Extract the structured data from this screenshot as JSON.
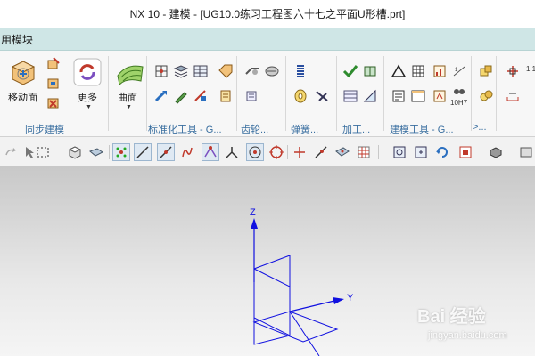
{
  "window": {
    "title": "NX 10 - 建模 - [UG10.0练习工程图六十七之平面U形槽.prt]"
  },
  "module_bar": {
    "label": "用模块"
  },
  "ribbon": {
    "groups": [
      {
        "label": "同步建模"
      },
      {
        "label": "标准化工具 - G..."
      },
      {
        "label": "齿轮..."
      },
      {
        "label": "弹簧..."
      },
      {
        "label": "加工..."
      },
      {
        "label": "建模工具 - G..."
      },
      {
        "label": ">..."
      }
    ],
    "move_face_label": "移动面",
    "more_label": "更多",
    "surface_label": "曲面",
    "badge_10h7": "10H7",
    "badge_scale": "1:1"
  },
  "viewport": {
    "z_label": "Z",
    "y_label": "Y",
    "axis_color": "#1010e0"
  },
  "watermark": {
    "brand": "Bai 经验",
    "url": "jingyan.baidu.com"
  }
}
